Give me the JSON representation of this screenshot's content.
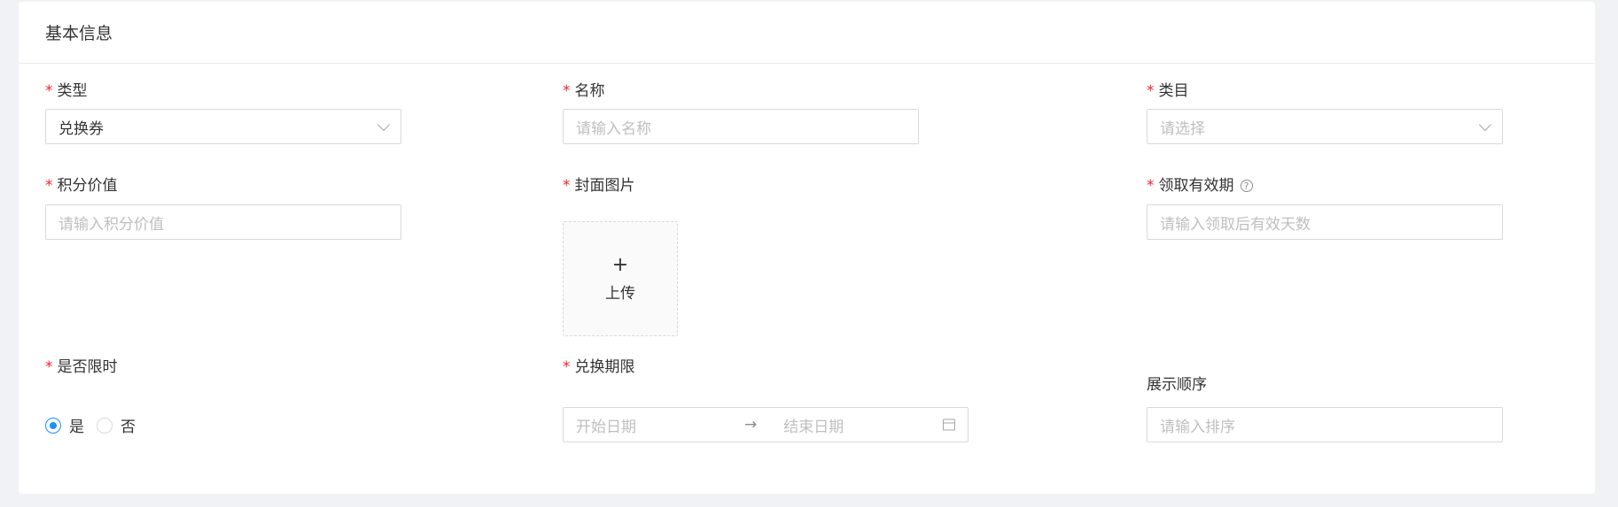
{
  "section": {
    "title": "基本信息"
  },
  "fields": {
    "type": {
      "label": "类型",
      "value": "兑换券"
    },
    "name": {
      "label": "名称",
      "placeholder": "请输入名称"
    },
    "category": {
      "label": "类目",
      "placeholder": "请选择"
    },
    "points": {
      "label": "积分价值",
      "placeholder": "请输入积分价值"
    },
    "cover": {
      "label": "封面图片",
      "upload_label": "上传",
      "plus": "+"
    },
    "validity": {
      "label": "领取有效期",
      "help_glyph": "?",
      "placeholder": "请输入领取后有效天数"
    },
    "limited": {
      "label": "是否限时",
      "options": [
        "是",
        "否"
      ],
      "selected": "是"
    },
    "period": {
      "label": "兑换期限",
      "start_placeholder": "开始日期",
      "separator": "→",
      "end_placeholder": "结束日期"
    },
    "sort": {
      "label": "展示顺序",
      "placeholder": "请输入排序"
    }
  },
  "colors": {
    "required": "#f5222d",
    "primary": "#1890ff",
    "placeholder": "#bfbfbf",
    "border": "#d9d9d9"
  },
  "icons": {
    "select_arrow": "chevron-down-icon",
    "help": "question-circle-icon",
    "calendar": "calendar-icon",
    "upload": "plus-icon"
  }
}
